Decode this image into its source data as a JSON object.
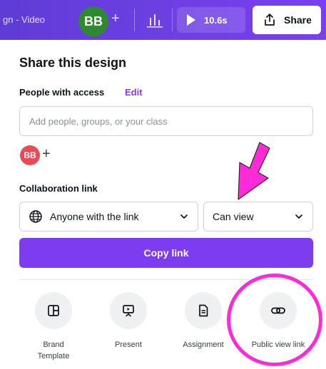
{
  "topbar": {
    "title": "gn - Video",
    "avatar_initials": "BB",
    "add_label": "+",
    "play_label": "10.6s",
    "share_label": "Share",
    "colors": {
      "gradient_start": "#5f3cd6",
      "gradient_end": "#7b3ff0",
      "avatar_bg": "#2f8a2f"
    }
  },
  "panel": {
    "title": "Share this design",
    "people_label": "People with access",
    "edit_label": "Edit",
    "input_placeholder": "Add people, groups, or your class",
    "avatar_initials": "BB",
    "add_person_label": "+",
    "collab_label": "Collaboration link",
    "access_dropdown": {
      "selected": "Anyone with the link",
      "icon": "globe-icon"
    },
    "permission_dropdown": {
      "selected": "Can view"
    },
    "copy_button_label": "Copy link",
    "accent_color": "#7d3cf0"
  },
  "options": [
    {
      "name": "brand-template",
      "label": "Brand Template",
      "icon": "brand-template-icon"
    },
    {
      "name": "present",
      "label": "Present",
      "icon": "present-icon"
    },
    {
      "name": "assignment",
      "label": "Assignment",
      "icon": "assignment-icon"
    },
    {
      "name": "public-view-link",
      "label": "Public view link",
      "icon": "link-icon"
    }
  ],
  "annotations": {
    "color": "#ff2bd6",
    "arrow_icon": "arrow-down-icon"
  }
}
